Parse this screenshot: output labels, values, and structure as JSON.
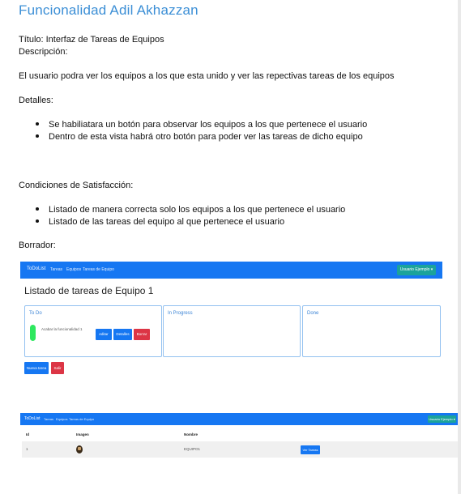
{
  "doc": {
    "title": "Funcionalidad Adil Akhazzan",
    "titulo": "Título: Interfaz de Tareas de Equipos",
    "descripcion_label": "Descripción:",
    "descripcion": "El usuario podra ver los equipos  a los que esta unido y ver las repectivas tareas de los equipos",
    "detalles_label": "Detalles:",
    "detalles": [
      "Se habiliatara un botón para observar los equipos a los que pertenece el usuario",
      "Dentro de esta vista habrá otro botón para poder ver las tareas de dicho equipo"
    ],
    "condiciones_label": "Condiciones de Satisfacción:",
    "condiciones": [
      "Listado de manera correcta solo los equipos a los que pertenece el usuario",
      "Listado de las tareas del equipo al que pertenece el usuario"
    ],
    "borrador_label": "Borrador:"
  },
  "mockup1": {
    "brand": "ToDoList",
    "nav_links": [
      "Tareas",
      "Equipos",
      "Tareas de Equipo"
    ],
    "user_menu": "Usuario Ejemplo ▾",
    "heading": "Listado de tareas de Equipo 1",
    "columns": [
      "To Do",
      "In Progress",
      "Done"
    ],
    "task": {
      "text": "Acabar la funcionalidad 1",
      "edit": "editar",
      "details": "Detalles",
      "delete": "Borrar"
    },
    "new_task": "Nueva tarea",
    "exit": "Salir",
    "colors": {
      "navbar": "#1677f2",
      "user": "#1ba39b",
      "danger": "#dc3545",
      "status": "#2ee85f"
    }
  },
  "mockup2": {
    "brand": "ToDoList",
    "nav_links": [
      "Tareas",
      "Equipos",
      "Tareas de Equipo"
    ],
    "user_menu": "Usuario Ejemplo ▾",
    "headers": [
      "Id",
      "Imagen",
      "Nombre"
    ],
    "row": {
      "id": "1",
      "nombre": "EQUIPO1",
      "action": "Ver Tareas"
    }
  }
}
